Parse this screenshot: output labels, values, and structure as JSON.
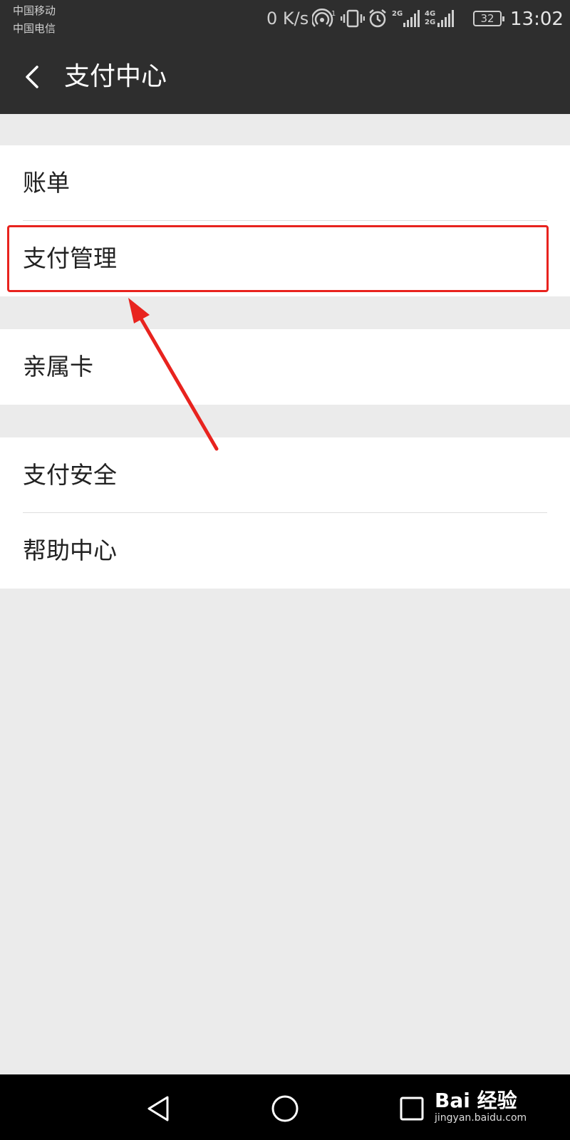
{
  "status_bar": {
    "carrier1": "中国移动",
    "carrier2": "中国电信",
    "network_speed": "0 K/s",
    "battery": "32",
    "time": "13:02",
    "icons": [
      "wifi-hotspot-icon",
      "vibrate-icon",
      "alarm-icon",
      "signal-2g-icon",
      "signal-4g-icon",
      "battery-icon"
    ]
  },
  "header": {
    "title": "支付中心",
    "back_icon": "back-arrow-icon"
  },
  "menu": {
    "group1": [
      {
        "label": "账单"
      },
      {
        "label": "支付管理"
      }
    ],
    "group2": [
      {
        "label": "亲属卡"
      }
    ],
    "group3": [
      {
        "label": "支付安全"
      },
      {
        "label": "帮助中心"
      }
    ]
  },
  "annotation": {
    "highlight_color": "#e8231e"
  },
  "nav_bar": {
    "icons": [
      "back-triangle-icon",
      "home-circle-icon",
      "recents-square-icon"
    ]
  },
  "watermark": {
    "brand": "Bai 经验",
    "url": "jingyan.baidu.com"
  },
  "colors": {
    "header_bg": "#2e2e2e",
    "page_bg": "#ebebeb",
    "card_bg": "#ffffff"
  }
}
